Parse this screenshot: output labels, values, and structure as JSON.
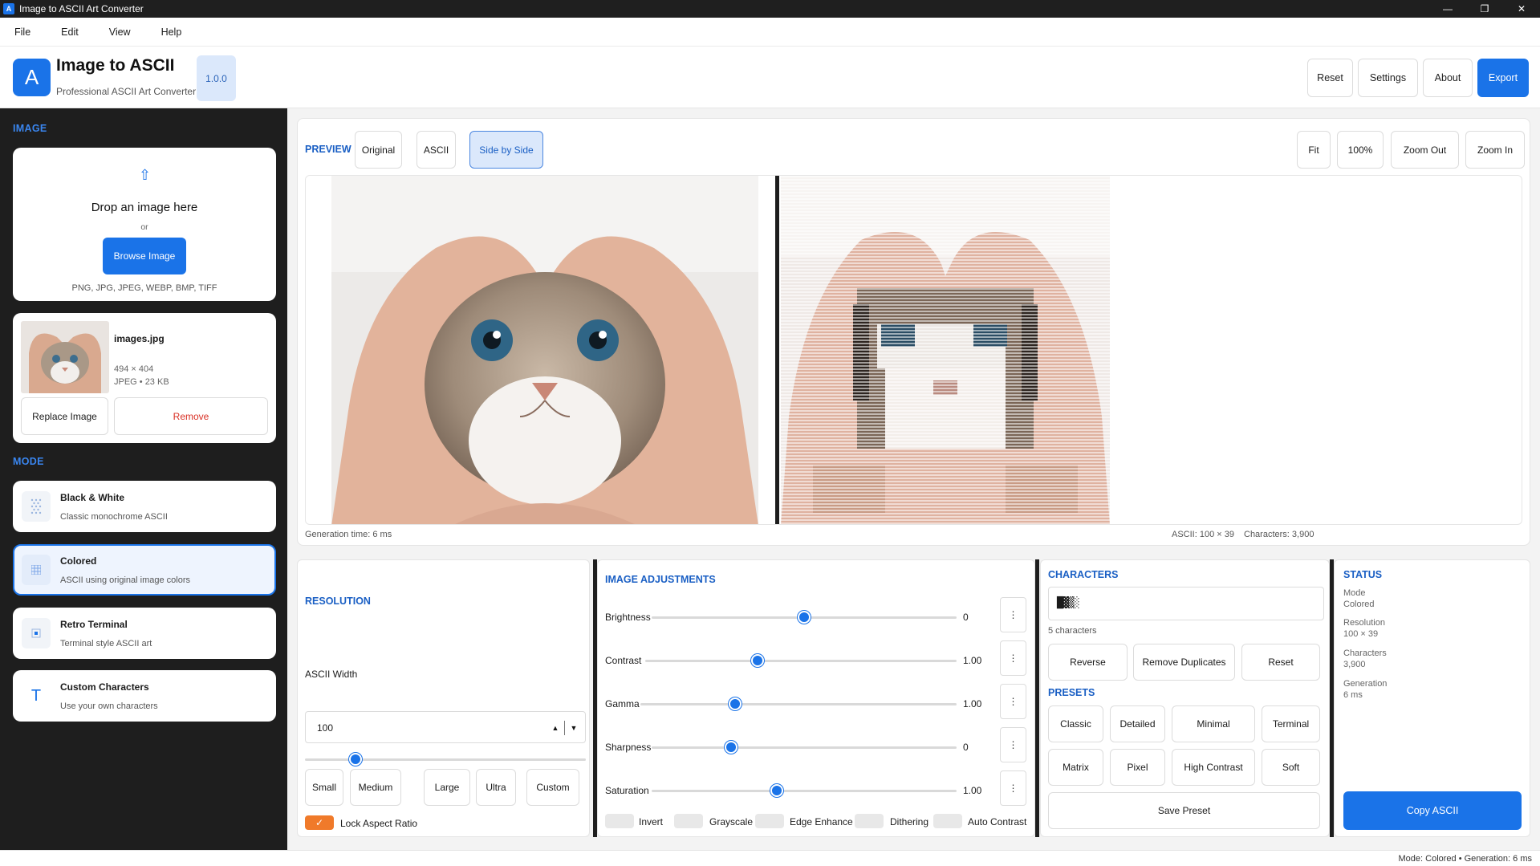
{
  "window": {
    "title": "Image to ASCII Art Converter",
    "app_icon": "A",
    "minimize": "—",
    "maximize": "❐",
    "close": "✕"
  },
  "menu": [
    "File",
    "Edit",
    "View",
    "Help"
  ],
  "header": {
    "logo": "A",
    "title": "Image to ASCII",
    "subtitle": "Professional ASCII Art Converter",
    "version": "1.0.0",
    "buttons": {
      "reset": "Reset",
      "settings": "Settings",
      "about": "About",
      "export": "Export"
    }
  },
  "sidebar": {
    "image_section": "IMAGE",
    "drop": {
      "icon": "upload-arrow-icon",
      "title": "Drop an image here",
      "or": "or",
      "browse": "Browse Image",
      "formats": "PNG, JPG, JPEG, WEBP, BMP, TIFF"
    },
    "file": {
      "name": "images.jpg",
      "dims": "494 × 404",
      "meta": "JPEG • 23 KB",
      "replace": "Replace Image",
      "remove": "Remove"
    },
    "mode_section": "MODE",
    "modes": [
      {
        "title": "Black & White",
        "desc": "Classic monochrome ASCII",
        "icon": "dots-grid-icon",
        "active": false
      },
      {
        "title": "Colored",
        "desc": "ASCII using original image colors",
        "icon": "grid-icon",
        "active": true
      },
      {
        "title": "Retro Terminal",
        "desc": "Terminal style ASCII art",
        "icon": "terminal-icon",
        "active": false
      },
      {
        "title": "Custom Characters",
        "desc": "Use your own characters",
        "icon": "text-icon",
        "glyph": "T",
        "active": false
      }
    ]
  },
  "preview": {
    "label": "PREVIEW",
    "tabs": {
      "original": "Original",
      "ascii": "ASCII",
      "side": "Side by Side"
    },
    "active_tab": "Side by Side",
    "zoom": {
      "fit": "Fit",
      "hundred": "100%",
      "zoom_out": "Zoom Out",
      "zoom_in": "Zoom In"
    },
    "generation_time": "Generation time: 6 ms",
    "ascii_size": "ASCII: 100 × 39",
    "characters": "Characters: 3,900"
  },
  "resolution": {
    "title": "RESOLUTION",
    "width_label": "ASCII Width",
    "width_value": "100",
    "slider_fraction": 0.18,
    "sizes": [
      "Small",
      "Medium",
      "Large",
      "Ultra",
      "Custom"
    ],
    "lock_label": "Lock Aspect Ratio",
    "lock_checked": true
  },
  "adjustments": {
    "title": "IMAGE ADJUSTMENTS",
    "items": [
      {
        "label": "Brightness",
        "value": "0",
        "fraction": 0.5
      },
      {
        "label": "Contrast",
        "value": "1.00",
        "fraction": 0.36
      },
      {
        "label": "Gamma",
        "value": "1.00",
        "fraction": 0.3
      },
      {
        "label": "Sharpness",
        "value": "0",
        "fraction": 0.26
      },
      {
        "label": "Saturation",
        "value": "1.00",
        "fraction": 0.41
      }
    ],
    "reset_glyph": "⋮",
    "toggles": [
      "Invert",
      "Grayscale",
      "Edge Enhance",
      "Dithering",
      "Auto Contrast"
    ]
  },
  "characters": {
    "title": "CHARACTERS",
    "chars": "█▓▒░ ",
    "count": "5 characters",
    "reverse": "Reverse",
    "remove_dup": "Remove Duplicates",
    "reset": "Reset",
    "presets_title": "PRESETS",
    "presets": [
      "Classic",
      "Detailed",
      "Minimal",
      "Terminal",
      "Matrix",
      "Pixel",
      "High Contrast",
      "Soft"
    ],
    "save_preset": "Save Preset"
  },
  "status": {
    "title": "STATUS",
    "mode_label": "Mode",
    "mode_value": "Colored",
    "res_label": "Resolution",
    "res_value": "100 × 39",
    "chars_label": "Characters",
    "chars_value": "3,900",
    "gen_label": "Generation",
    "gen_value": "6 ms",
    "copy": "Copy ASCII"
  },
  "statusbar": {
    "text": "Mode: Colored • Generation: 6 ms"
  },
  "colors": {
    "accent": "#1a73e8",
    "sidebar": "#1e1e1e",
    "remove": "#d93025",
    "check": "#f07a2a"
  }
}
